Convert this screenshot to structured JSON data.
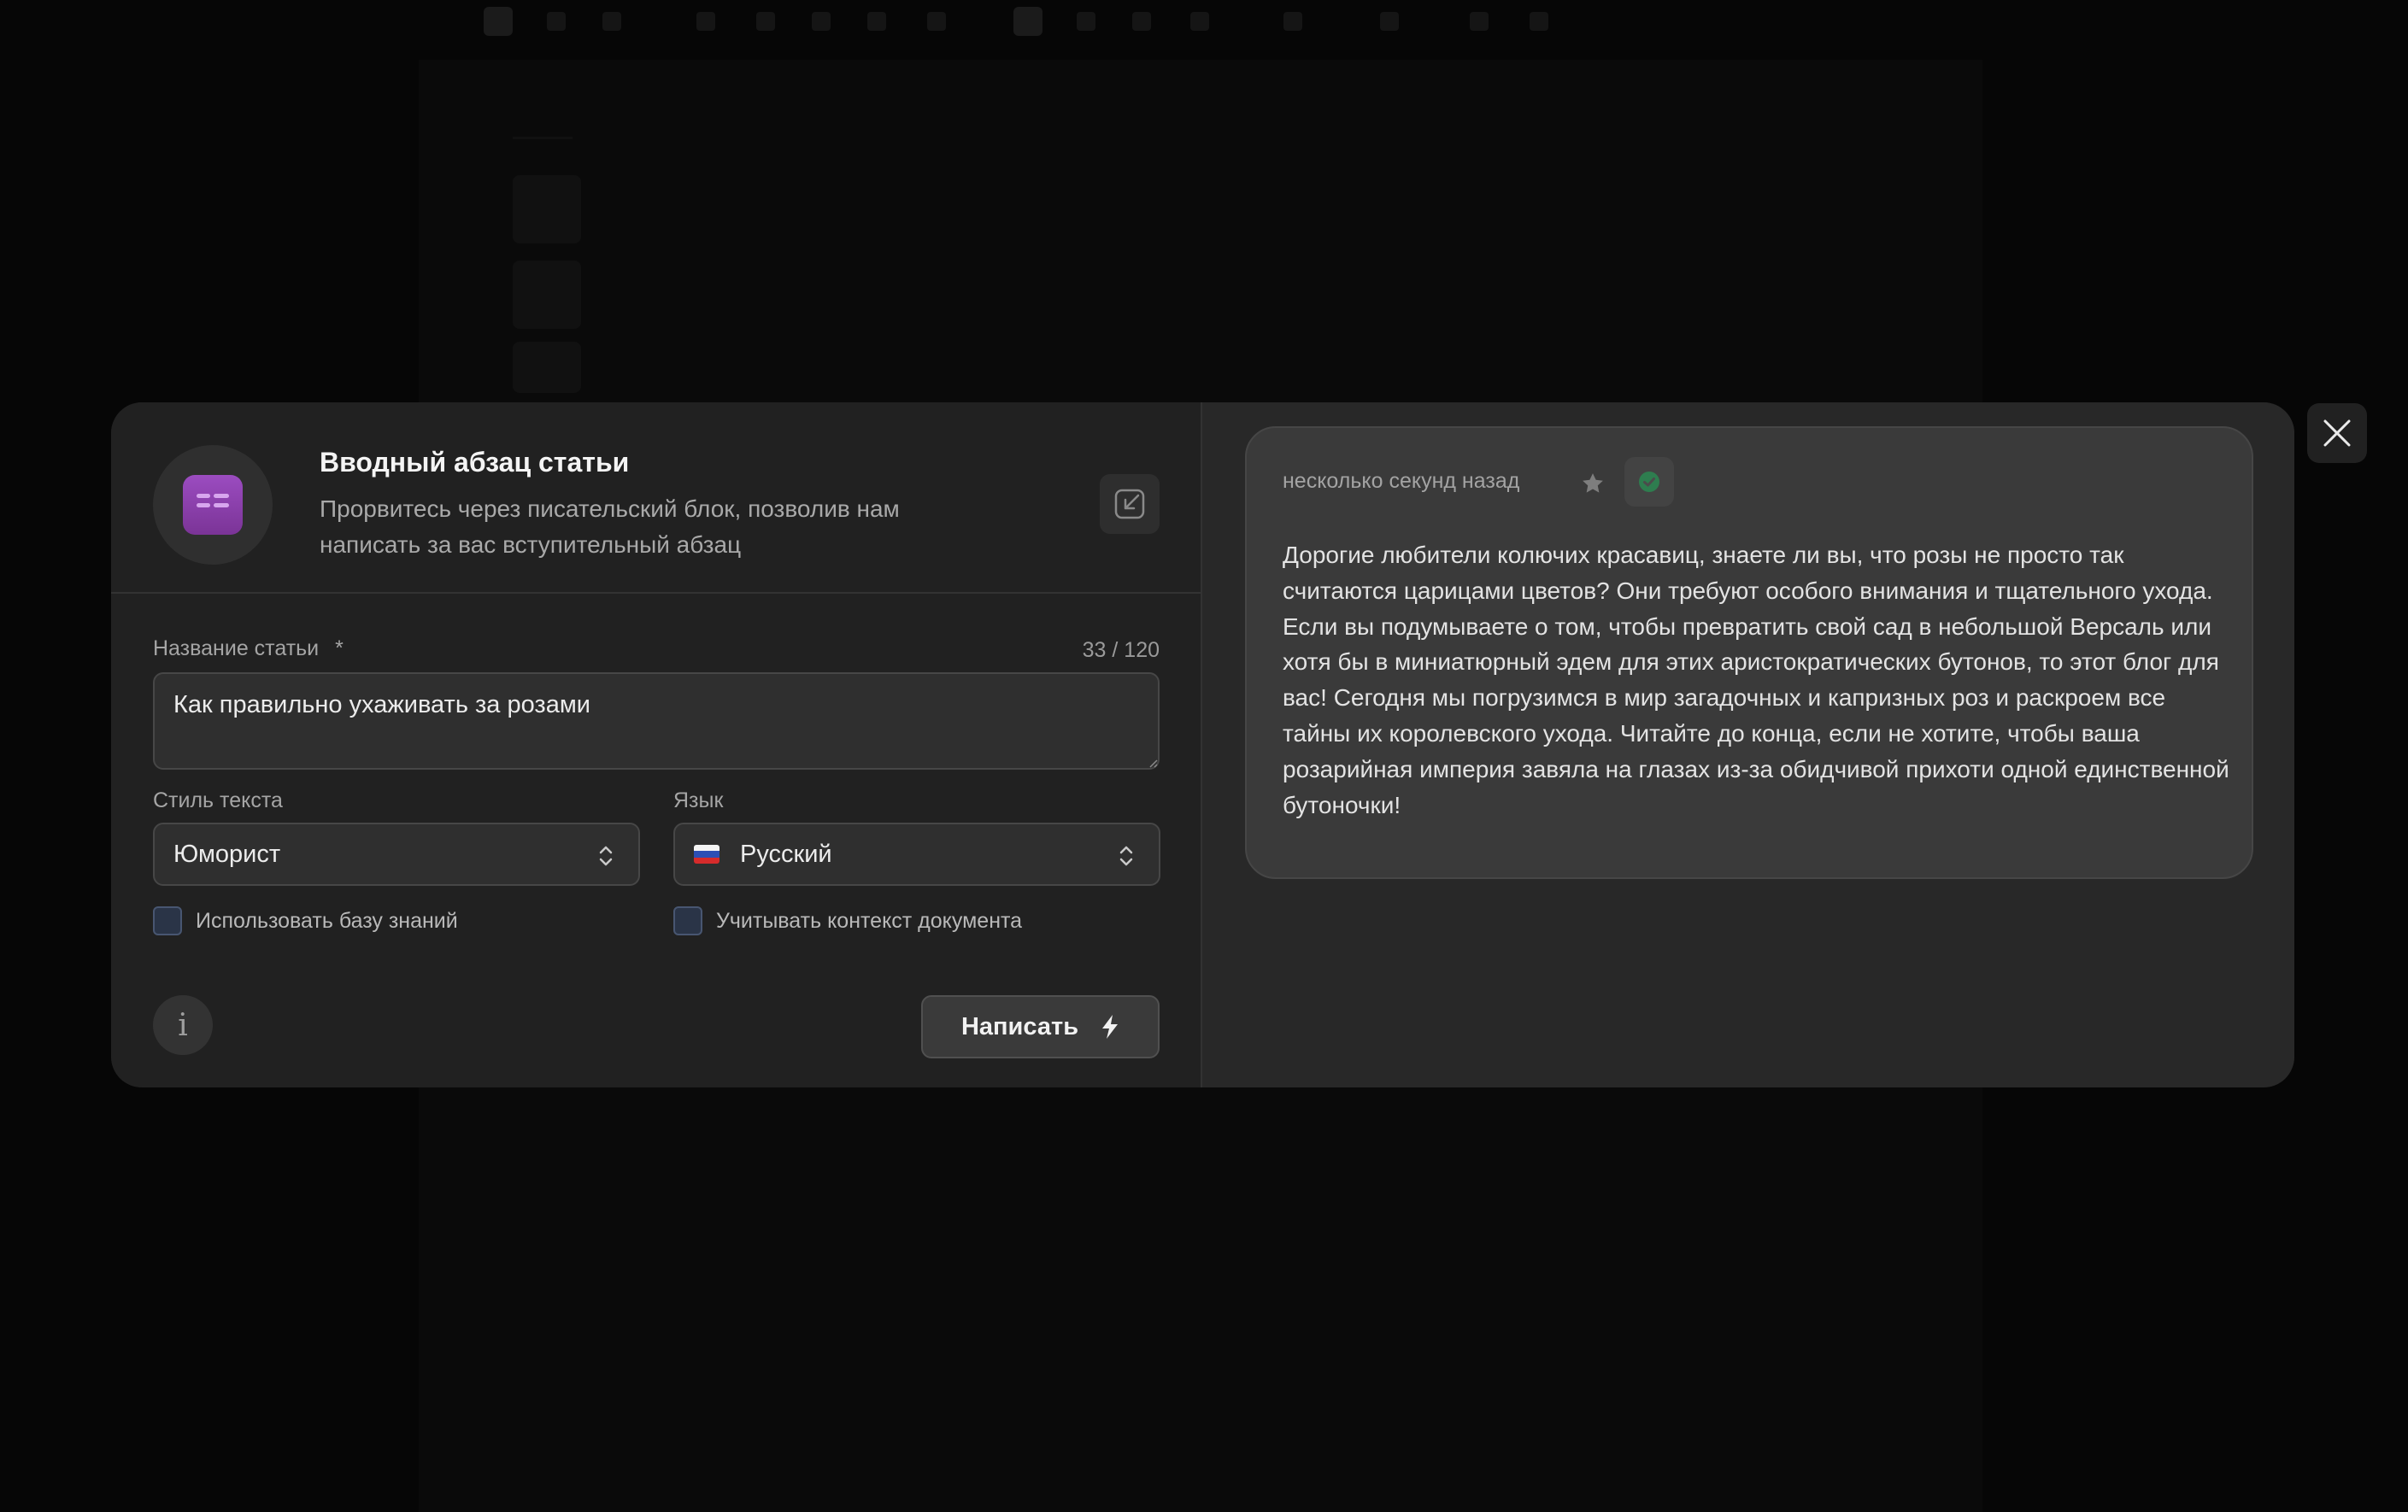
{
  "modal": {
    "title": "Вводный абзац статьи",
    "description": "Прорвитесь через писательский блок, позволив нам написать за вас вступительный абзац",
    "block_icon": "paragraph-block-icon",
    "collapse_icon": "collapse-arrow-icon",
    "form": {
      "title_label": "Название статьи",
      "required_mark": "*",
      "counter": "33 / 120",
      "title_value": "Как правильно ухаживать за розами",
      "style_label": "Стиль текста",
      "style_value": "Юморист",
      "language_label": "Язык",
      "language_value": "Русский",
      "language_flag": "russia-flag-icon",
      "knowledge_base_label": "Использовать базу знаний",
      "document_context_label": "Учитывать контекст документа",
      "info_icon": "i",
      "write_label": "Написать"
    },
    "result": {
      "time": "несколько секунд назад",
      "text": "Дорогие любители колючих красавиц, знаете ли вы, что розы не просто так считаются царицами цветов? Они требуют особого внимания и тщательного ухода. Если вы подумываете о том, чтобы превратить свой сад в небольшой Версаль или хотя бы в миниатюрный эдем для этих аристократических бутонов, то этот блог для вас! Сегодня мы погрузимся в мир загадочных и капризных роз и раскроем все тайны их королевского ухода. Читайте до конца, если не хотите, чтобы ваша розарийная империя завяла на глазах из-за обидчивой прихоти одной единственной бутоночки!"
    }
  },
  "colors": {
    "accent_purple": "#8e44ad",
    "success_green": "#2e7d4f",
    "background": "#060606"
  }
}
